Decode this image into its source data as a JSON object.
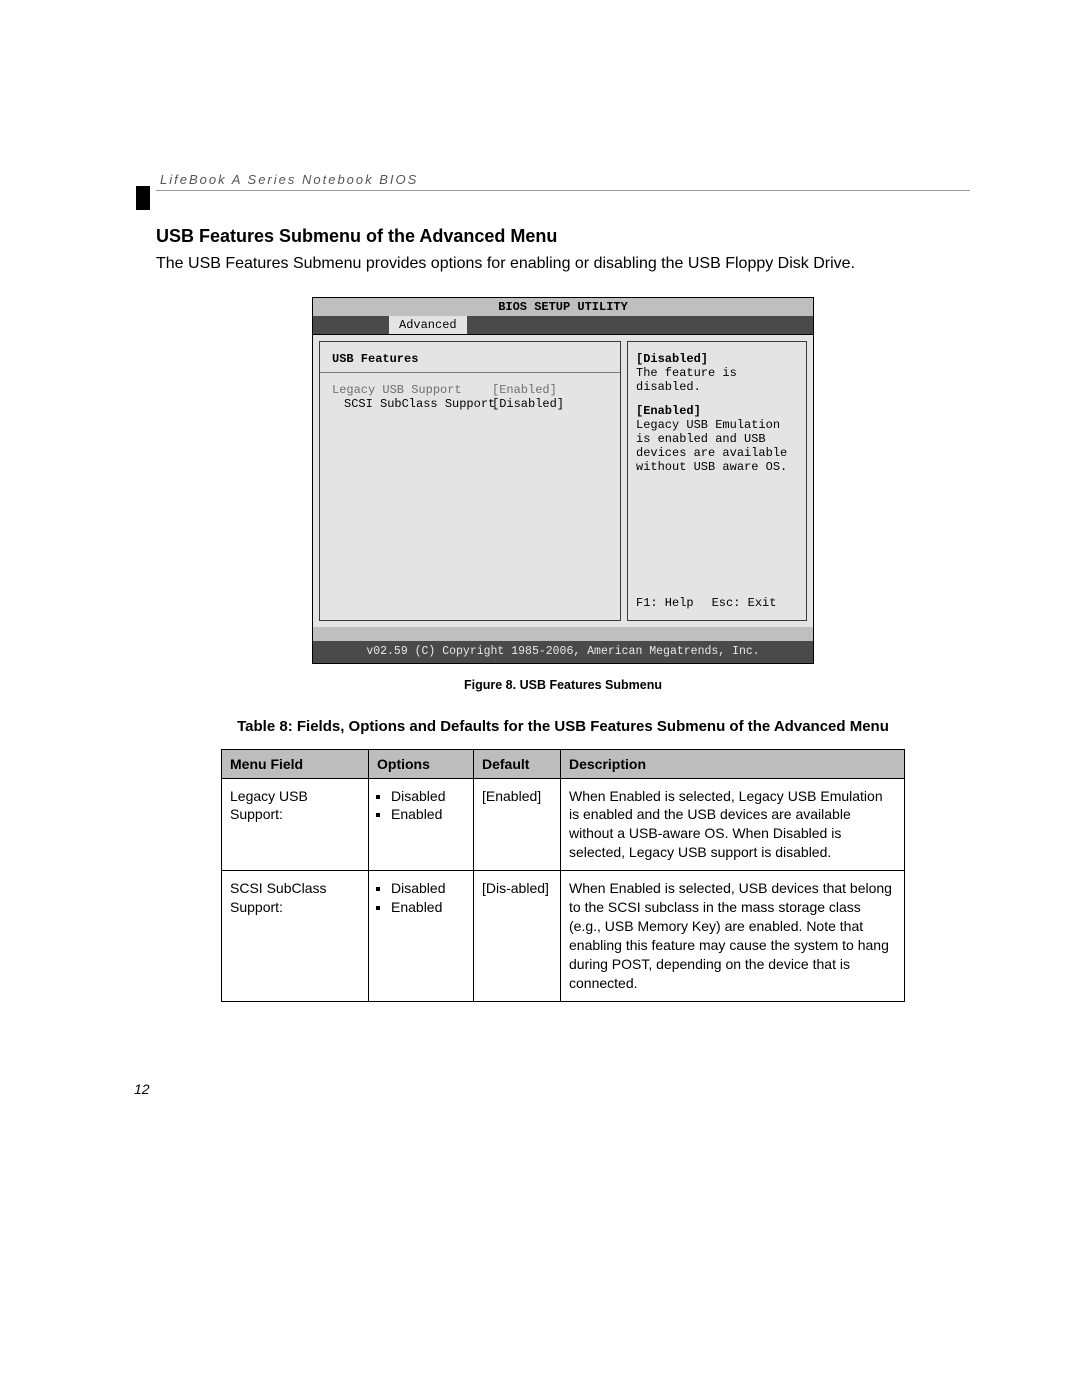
{
  "running_head": "LifeBook A Series Notebook BIOS",
  "section_heading": "USB Features Submenu of the Advanced Menu",
  "body_text": "The USB Features Submenu provides options for enabling or disabling the USB Floppy Disk Drive.",
  "bios": {
    "title": "BIOS SETUP UTILITY",
    "active_tab": "Advanced",
    "panel_title": "USB Features",
    "rows": [
      {
        "label": "Legacy USB Support",
        "value": "[Enabled]"
      },
      {
        "label": "SCSI SubClass Support",
        "value": "[Disabled]"
      }
    ],
    "help": {
      "disabled_label": "[Disabled]",
      "disabled_text": "The feature is disabled.",
      "enabled_label": "[Enabled]",
      "enabled_text": "Legacy USB Emulation is enabled and USB devices are available without USB aware OS."
    },
    "footer_help": "F1: Help",
    "footer_exit": "Esc: Exit",
    "copyright": "v02.59 (C) Copyright 1985-2006, American Megatrends, Inc."
  },
  "figure_caption": "Figure 8.  USB Features Submenu",
  "table_caption": "Table 8: Fields, Options and Defaults for the USB Features Submenu of the Advanced Menu",
  "table": {
    "headers": {
      "field": "Menu Field",
      "options": "Options",
      "default": "Default",
      "description": "Description"
    },
    "rows": [
      {
        "field": "Legacy USB Support:",
        "options": [
          "Disabled",
          "Enabled"
        ],
        "default": "[Enabled]",
        "description": "When Enabled is selected, Legacy USB Emulation is enabled and the USB devices are available without a USB-aware OS. When Disabled is selected, Legacy USB support is disabled."
      },
      {
        "field": "SCSI SubClass Support:",
        "options": [
          "Disabled",
          "Enabled"
        ],
        "default": "[Dis-abled]",
        "description": "When Enabled is selected, USB devices that belong to the SCSI subclass in the mass storage class (e.g., USB Memory Key) are enabled. Note that enabling this feature may cause the system to hang during POST, depending on the device that is connected."
      }
    ]
  },
  "page_number": "12"
}
